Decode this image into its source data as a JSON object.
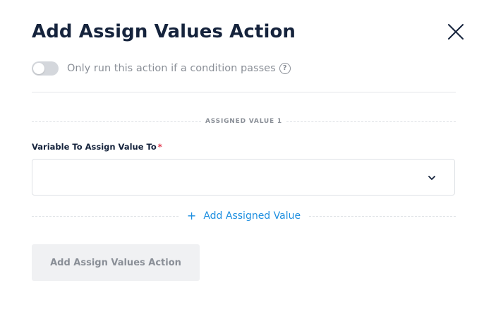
{
  "modal": {
    "title": "Add Assign Values Action"
  },
  "condition": {
    "label": "Only run this action if a condition passes",
    "help": "?",
    "enabled": false
  },
  "section": {
    "label": "ASSIGNED VALUE 1"
  },
  "field": {
    "label": "Variable To Assign Value To",
    "required_marker": "*",
    "value": ""
  },
  "add_value": {
    "plus": "+",
    "label": "Add Assigned Value"
  },
  "submit": {
    "label": "Add Assign Values Action"
  },
  "icons": {
    "close": "close-icon",
    "chevron": "chevron-down-icon",
    "help": "help-circle-icon"
  },
  "colors": {
    "title": "#15233c",
    "link": "#1e8fe0",
    "required": "#e0344a",
    "muted": "#8a8f97",
    "toggle_off": "#d4d7dc",
    "button_disabled_bg": "#f0f1f3"
  }
}
